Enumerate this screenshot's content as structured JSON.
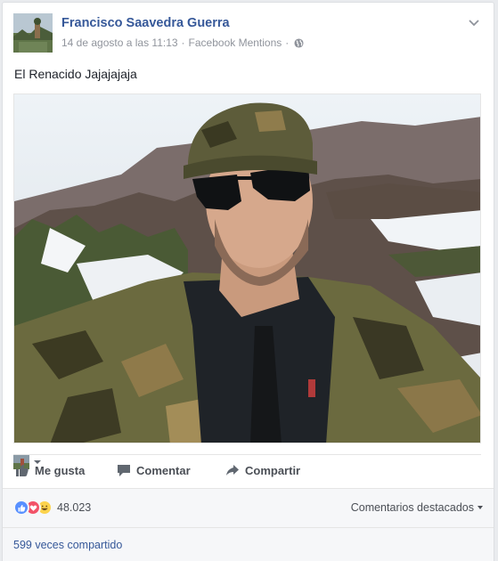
{
  "post": {
    "author": "Francisco Saavedra Guerra",
    "date": "14 de agosto a las 11:13",
    "separator": "·",
    "source": "Facebook Mentions",
    "privacy_icon": "globe-icon",
    "text": "El Renacido Jajajajaja"
  },
  "actions": {
    "like": "Me gusta",
    "comment": "Comentar",
    "share": "Compartir"
  },
  "stats": {
    "reactions": [
      "like",
      "love",
      "haha"
    ],
    "reaction_count": "48.023",
    "featured_comments": "Comentarios destacados",
    "shares": "599 veces compartido"
  },
  "colors": {
    "link": "#365899",
    "like_reaction": "#5890ff",
    "love_reaction": "#f25268",
    "haha_reaction": "#fcd34d"
  }
}
